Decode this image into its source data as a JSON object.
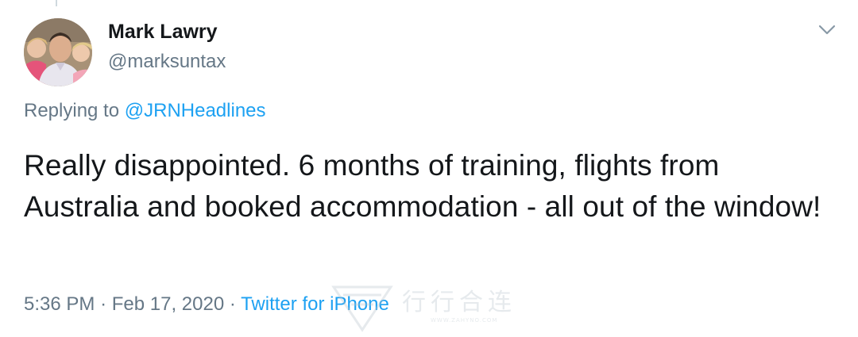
{
  "tweet": {
    "author_name": "Mark Lawry",
    "author_handle": "@marksuntax",
    "replying_prefix": "Replying to ",
    "replying_to": "@JRNHeadlines",
    "text": "Really disappointed. 6 months of training, flights from Australia and booked accommodation - all out of the window!",
    "time": "5:36 PM",
    "separator": "·",
    "date": "Feb 17, 2020",
    "source": "Twitter for iPhone"
  },
  "icons": {
    "menu": "chevron-down-icon",
    "avatar": "avatar-photo"
  },
  "watermark": {
    "text": "行行合连",
    "url": "WWW.ZAHYNO.COM"
  },
  "colors": {
    "link": "#1da1f2",
    "secondary_text": "#657786",
    "primary_text": "#14171a"
  }
}
